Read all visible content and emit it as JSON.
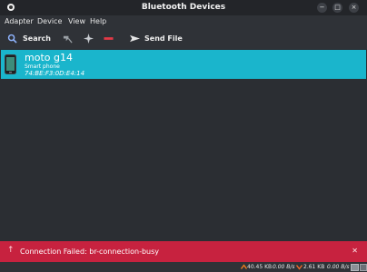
{
  "window": {
    "title": "Bluetooth Devices"
  },
  "menu": [
    "Adapter",
    "Device",
    "View",
    "Help"
  ],
  "toolbar": {
    "search_label": "Search",
    "send_file_label": "Send File"
  },
  "devices": [
    {
      "name": "moto g14",
      "type": "Smart phone",
      "mac": "74:BE:F3:0D:E4:14"
    }
  ],
  "error": {
    "message": "Connection Failed: br-connection-busy"
  },
  "status": {
    "upload_total": "40.45 KB",
    "upload_rate": "0.00 B/s",
    "download_total": "2.61 KB",
    "download_rate": "0.00 B/s"
  },
  "colors": {
    "selection": "#1ab5cc",
    "error": "#c7223f",
    "upload_arrow": "#f07c1e",
    "download_arrow": "#ef6a2a"
  }
}
